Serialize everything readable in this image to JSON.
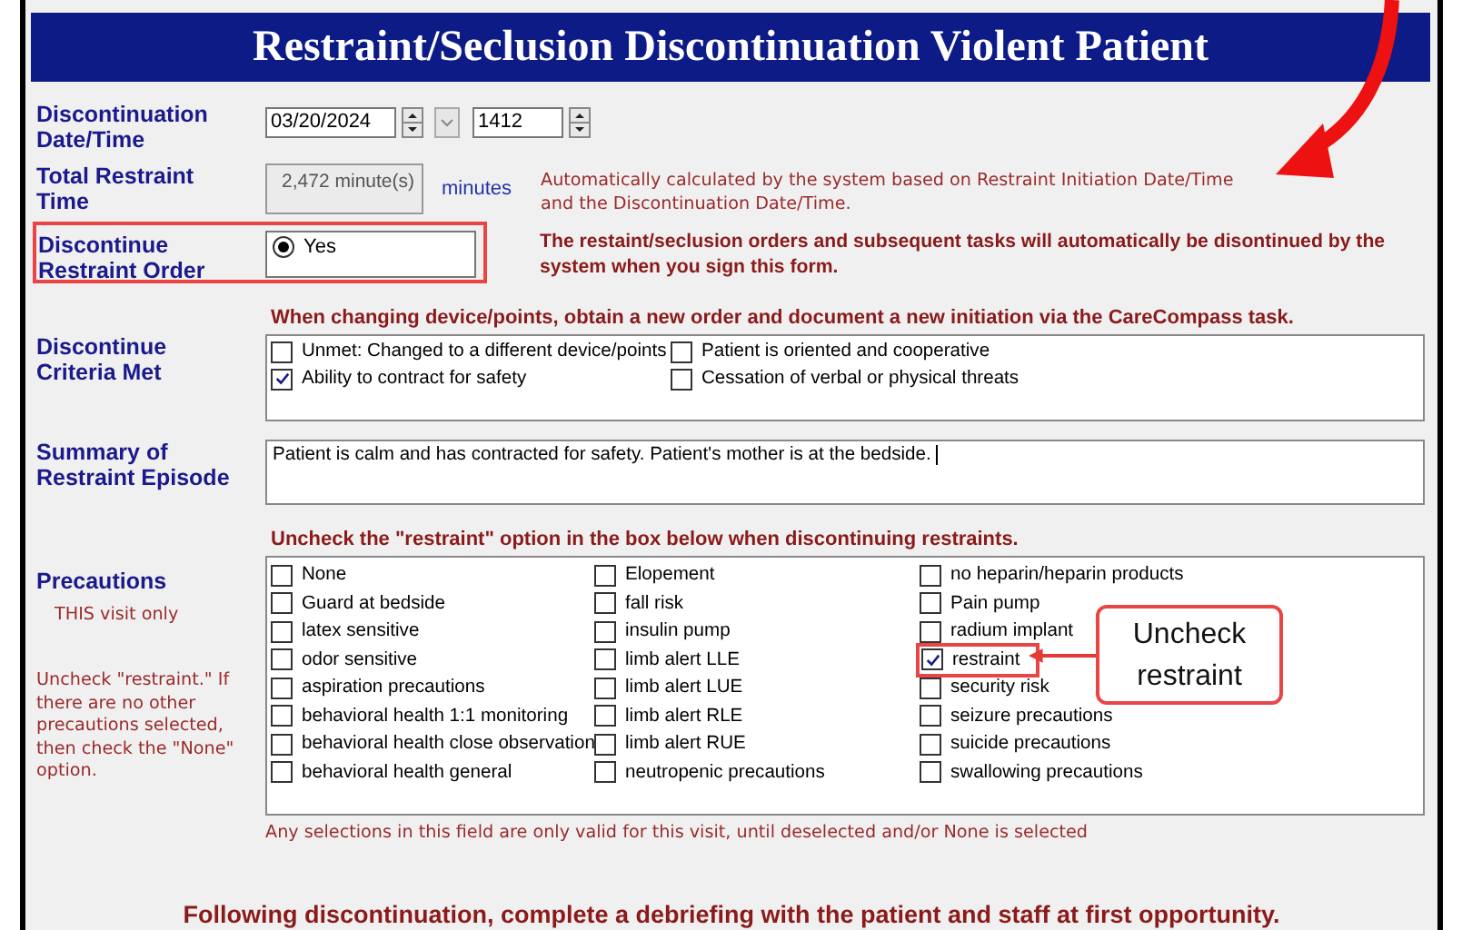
{
  "title": "Restraint/Seclusion Discontinuation Violent Patient",
  "discontinuation": {
    "label": "Discontinuation Date/Time",
    "date": "03/20/2024",
    "time": "1412"
  },
  "total_time": {
    "label": "Total Restraint Time",
    "value": "2,472 minute(s)",
    "unit": "minutes",
    "note": "Automatically calculated by the system based on Restraint Initiation Date/Time and the Discontinuation Date/Time."
  },
  "discontinue_order": {
    "label": "Discontinue Restraint Order",
    "highlighted": true,
    "options": [
      {
        "label": "Yes",
        "selected": true
      }
    ],
    "note": "The restaint/seclusion orders and subsequent tasks will automatically be disontinued by the system when you sign this form."
  },
  "criteria": {
    "heading": "When changing device/points, obtain a new order and document a new initiation via the CareCompass task.",
    "label": "Discontinue Criteria Met",
    "options": [
      {
        "label": "Unmet: Changed to a different device/points",
        "checked": false
      },
      {
        "label": "Ability to contract for safety",
        "checked": true
      },
      {
        "label": "Patient is oriented and cooperative",
        "checked": false
      },
      {
        "label": "Cessation of verbal or physical threats",
        "checked": false
      }
    ]
  },
  "summary": {
    "label": "Summary of Restraint Episode",
    "value": "Patient is calm and has contracted for safety. Patient's mother is at the bedside."
  },
  "precautions": {
    "heading": "Uncheck the \"restraint\" option in the box below when discontinuing restraints.",
    "label": "Precautions",
    "sublabel": "THIS visit only",
    "instruction": "Uncheck \"restraint.\" If there  are no other precautions selected, then check the \"None\" option.",
    "options": [
      {
        "label": "None",
        "checked": false,
        "highlighted": false
      },
      {
        "label": "Guard at bedside",
        "checked": false,
        "highlighted": false
      },
      {
        "label": "latex sensitive",
        "checked": false,
        "highlighted": false
      },
      {
        "label": "odor sensitive",
        "checked": false,
        "highlighted": false
      },
      {
        "label": "aspiration precautions",
        "checked": false,
        "highlighted": false
      },
      {
        "label": "behavioral health 1:1 monitoring",
        "checked": false,
        "highlighted": false
      },
      {
        "label": "behavioral health close observation",
        "checked": false,
        "highlighted": false
      },
      {
        "label": "behavioral health general",
        "checked": false,
        "highlighted": false
      },
      {
        "label": "Elopement",
        "checked": false,
        "highlighted": false
      },
      {
        "label": "fall risk",
        "checked": false,
        "highlighted": false
      },
      {
        "label": "insulin pump",
        "checked": false,
        "highlighted": false
      },
      {
        "label": "limb alert LLE",
        "checked": false,
        "highlighted": false
      },
      {
        "label": "limb alert LUE",
        "checked": false,
        "highlighted": false
      },
      {
        "label": "limb alert RLE",
        "checked": false,
        "highlighted": false
      },
      {
        "label": "limb alert RUE",
        "checked": false,
        "highlighted": false
      },
      {
        "label": "neutropenic precautions",
        "checked": false,
        "highlighted": false
      },
      {
        "label": "no heparin/heparin products",
        "checked": false,
        "highlighted": false
      },
      {
        "label": "Pain pump",
        "checked": false,
        "highlighted": false
      },
      {
        "label": "radium implant",
        "checked": false,
        "highlighted": false
      },
      {
        "label": "restraint",
        "checked": true,
        "highlighted": true
      },
      {
        "label": "security risk",
        "checked": false,
        "highlighted": false
      },
      {
        "label": "seizure precautions",
        "checked": false,
        "highlighted": false
      },
      {
        "label": "suicide precautions",
        "checked": false,
        "highlighted": false
      },
      {
        "label": "swallowing precautions",
        "checked": false,
        "highlighted": false
      }
    ],
    "note": "Any selections in this field are only valid for this visit, until deselected and/or None is selected"
  },
  "callout": {
    "text": "Uncheck restraint"
  },
  "footer": "Following discontinuation, complete a debriefing with the patient and staff at first opportunity."
}
